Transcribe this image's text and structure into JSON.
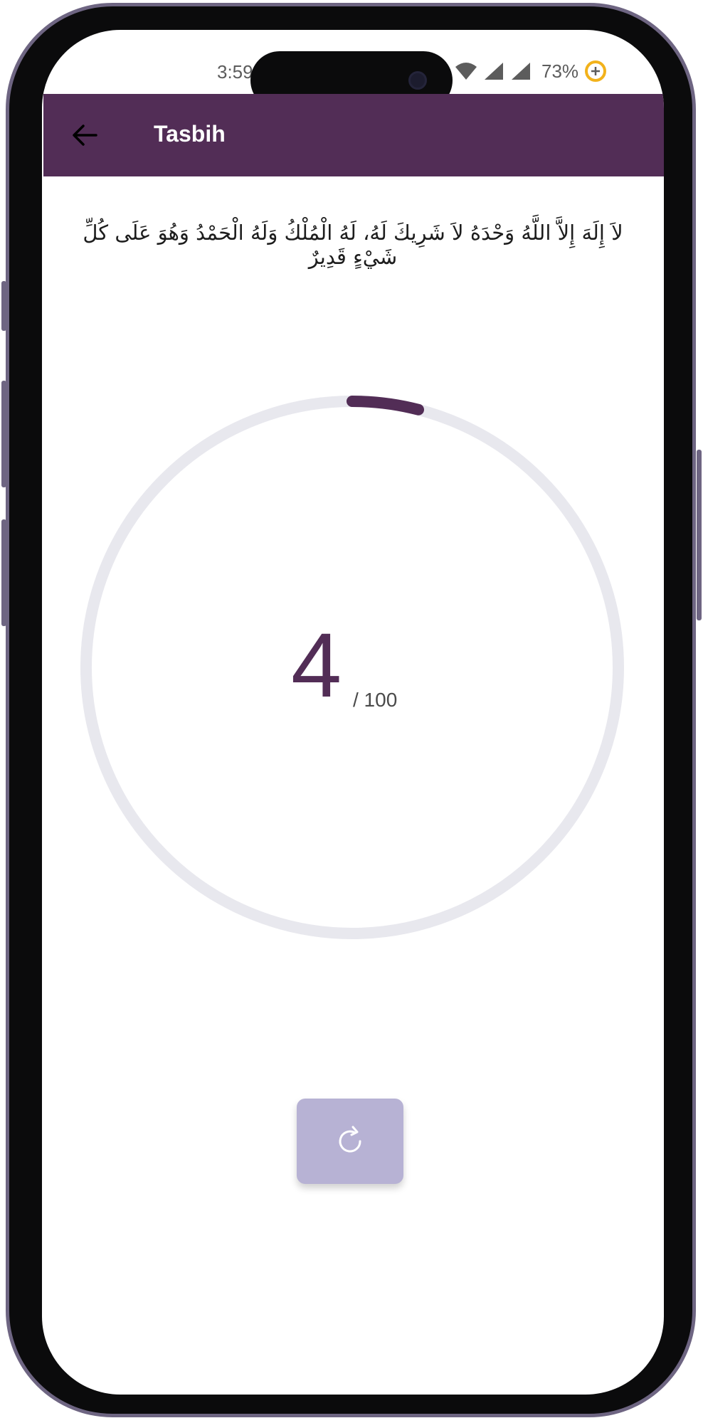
{
  "status_bar": {
    "time": "3:59",
    "battery": "73%",
    "icons": [
      "wifi-icon",
      "signal-icon",
      "signal-icon",
      "battery-saver-icon"
    ]
  },
  "app_bar": {
    "title": "Tasbih",
    "back_icon": "arrow-left-icon"
  },
  "dhikr": {
    "arabic": "لاَ إِلَهَ إِلاَّ اللَّهُ وَحْدَهُ لاَ شَرِيكَ لَهُ، لَهُ الْمُلْكُ وَلَهُ الْحَمْدُ وَهُوَ عَلَى كُلِّ شَيْءٍ قَدِيرٌ"
  },
  "counter": {
    "count": "4",
    "total_label": "/ 100",
    "progress": 0.04
  },
  "reset_button": {
    "icon": "refresh-icon"
  },
  "colors": {
    "primary": "#522d56",
    "ring_track": "#e8e8ee",
    "reset_bg": "#b7b2d4"
  }
}
